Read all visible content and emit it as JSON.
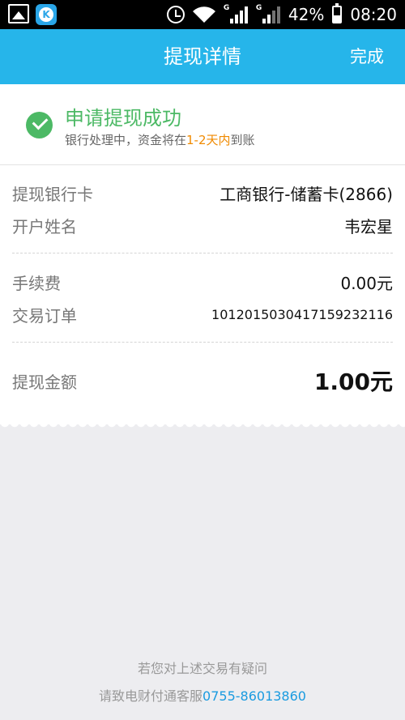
{
  "status_bar": {
    "battery": "42%",
    "time": "08:20",
    "network_type": "G",
    "app_icon_letter": "K"
  },
  "nav": {
    "title": "提现详情",
    "done_label": "完成"
  },
  "success": {
    "title": "申请提现成功",
    "sub_prefix": "银行处理中，资金将在",
    "sub_highlight": "1-2天内",
    "sub_suffix": "到账"
  },
  "details": {
    "bank_card_label": "提现银行卡",
    "bank_card_value": "工商银行-储蓄卡(2866)",
    "account_name_label": "开户姓名",
    "account_name_value": "韦宏星",
    "fee_label": "手续费",
    "fee_value": "0.00元",
    "order_label": "交易订单",
    "order_value": "1012015030417159232116",
    "amount_label": "提现金额",
    "amount_value": "1.00元"
  },
  "footer": {
    "line1": "若您对上述交易有疑问",
    "line2_prefix": "请致电财付通客服",
    "phone": "0755-86013860"
  },
  "colors": {
    "nav": "#26b5ea",
    "success": "#4cb965",
    "highlight": "#f08a00",
    "link": "#1a9be0"
  }
}
